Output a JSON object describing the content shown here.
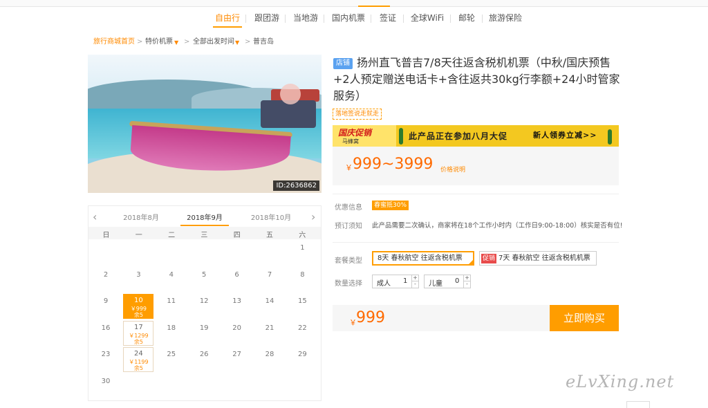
{
  "nav": {
    "items": [
      "自由行",
      "跟团游",
      "当地游",
      "国内机票",
      "签证",
      "全球WiFi",
      "邮轮",
      "旅游保险"
    ],
    "active": "自由行"
  },
  "breadcrumb": {
    "home": "旅行商城首页",
    "sep": ">",
    "cat": "特价机票",
    "depart": "全部出发时间",
    "dest": "普吉岛"
  },
  "photo": {
    "id_text": "ID:2636862"
  },
  "calendar": {
    "prev": "2018年8月",
    "current": "2018年9月",
    "next": "2018年10月",
    "weekdays": [
      "日",
      "一",
      "二",
      "三",
      "四",
      "五",
      "六"
    ],
    "days": [
      {
        "d": "1",
        "row": 0,
        "col": 6
      },
      {
        "d": "2",
        "row": 1,
        "col": 0
      },
      {
        "d": "3",
        "row": 1,
        "col": 1
      },
      {
        "d": "4",
        "row": 1,
        "col": 2
      },
      {
        "d": "5",
        "row": 1,
        "col": 3
      },
      {
        "d": "6",
        "row": 1,
        "col": 4
      },
      {
        "d": "7",
        "row": 1,
        "col": 5
      },
      {
        "d": "8",
        "row": 1,
        "col": 6
      },
      {
        "d": "9",
        "row": 2,
        "col": 0
      },
      {
        "d": "10",
        "row": 2,
        "col": 1,
        "price": "￥999",
        "stock": "余5",
        "state": "selected"
      },
      {
        "d": "11",
        "row": 2,
        "col": 2
      },
      {
        "d": "12",
        "row": 2,
        "col": 3
      },
      {
        "d": "13",
        "row": 2,
        "col": 4
      },
      {
        "d": "14",
        "row": 2,
        "col": 5
      },
      {
        "d": "15",
        "row": 2,
        "col": 6
      },
      {
        "d": "16",
        "row": 3,
        "col": 0
      },
      {
        "d": "17",
        "row": 3,
        "col": 1,
        "price": "￥1299",
        "stock": "余5",
        "state": "available"
      },
      {
        "d": "18",
        "row": 3,
        "col": 2
      },
      {
        "d": "19",
        "row": 3,
        "col": 3
      },
      {
        "d": "20",
        "row": 3,
        "col": 4
      },
      {
        "d": "21",
        "row": 3,
        "col": 5
      },
      {
        "d": "22",
        "row": 3,
        "col": 6
      },
      {
        "d": "23",
        "row": 4,
        "col": 0
      },
      {
        "d": "24",
        "row": 4,
        "col": 1,
        "price": "￥1199",
        "stock": "余5",
        "state": "available"
      },
      {
        "d": "25",
        "row": 4,
        "col": 2
      },
      {
        "d": "26",
        "row": 4,
        "col": 3
      },
      {
        "d": "27",
        "row": 4,
        "col": 4
      },
      {
        "d": "28",
        "row": 4,
        "col": 5
      },
      {
        "d": "29",
        "row": 4,
        "col": 6
      },
      {
        "d": "30",
        "row": 5,
        "col": 0
      }
    ]
  },
  "product": {
    "shop_badge": "店铺",
    "title": "扬州直飞普吉7/8天往返含税机机票（中秋/国庆预售+2人预定赠送电话卡+含往返共30kg行李额+24小时管家服务）",
    "local_tag": "落地签说走就走"
  },
  "banner": {
    "guoqing": "国庆促销",
    "mfw": "马蜂窝",
    "mid": "此产品正在参加八月大促",
    "right": "新人领券立减>>"
  },
  "price": {
    "currency": "￥",
    "range": "999~3999",
    "link": "价格说明"
  },
  "info": {
    "promo_label": "优惠信息",
    "promo_tag": "春蜜抵30%",
    "notice_label": "预订须知",
    "notice_text": "此产品需要二次确认，商家将在18个工作小时内（工作日9:00-18:00）核实是否有位!"
  },
  "package": {
    "label": "套餐类型",
    "options": [
      {
        "text": "8天 春秋航空 往返含税机票",
        "selected": true
      },
      {
        "sale": "促销",
        "text": "7天 春秋航空 往返含税机机票",
        "selected": false
      }
    ]
  },
  "quantity": {
    "label": "数量选择",
    "adult_label": "成人",
    "adult_value": "1",
    "child_label": "儿童",
    "child_value": "0",
    "plus": "+",
    "minus": "-"
  },
  "buy": {
    "currency": "￥",
    "total": "999",
    "button": "立即购买"
  },
  "watermark": "eLvXing.net",
  "colors": {
    "accent": "#ff9d00",
    "price": "#ff6a00",
    "badge": "#5ba2f0",
    "sale": "#e84b4b"
  }
}
